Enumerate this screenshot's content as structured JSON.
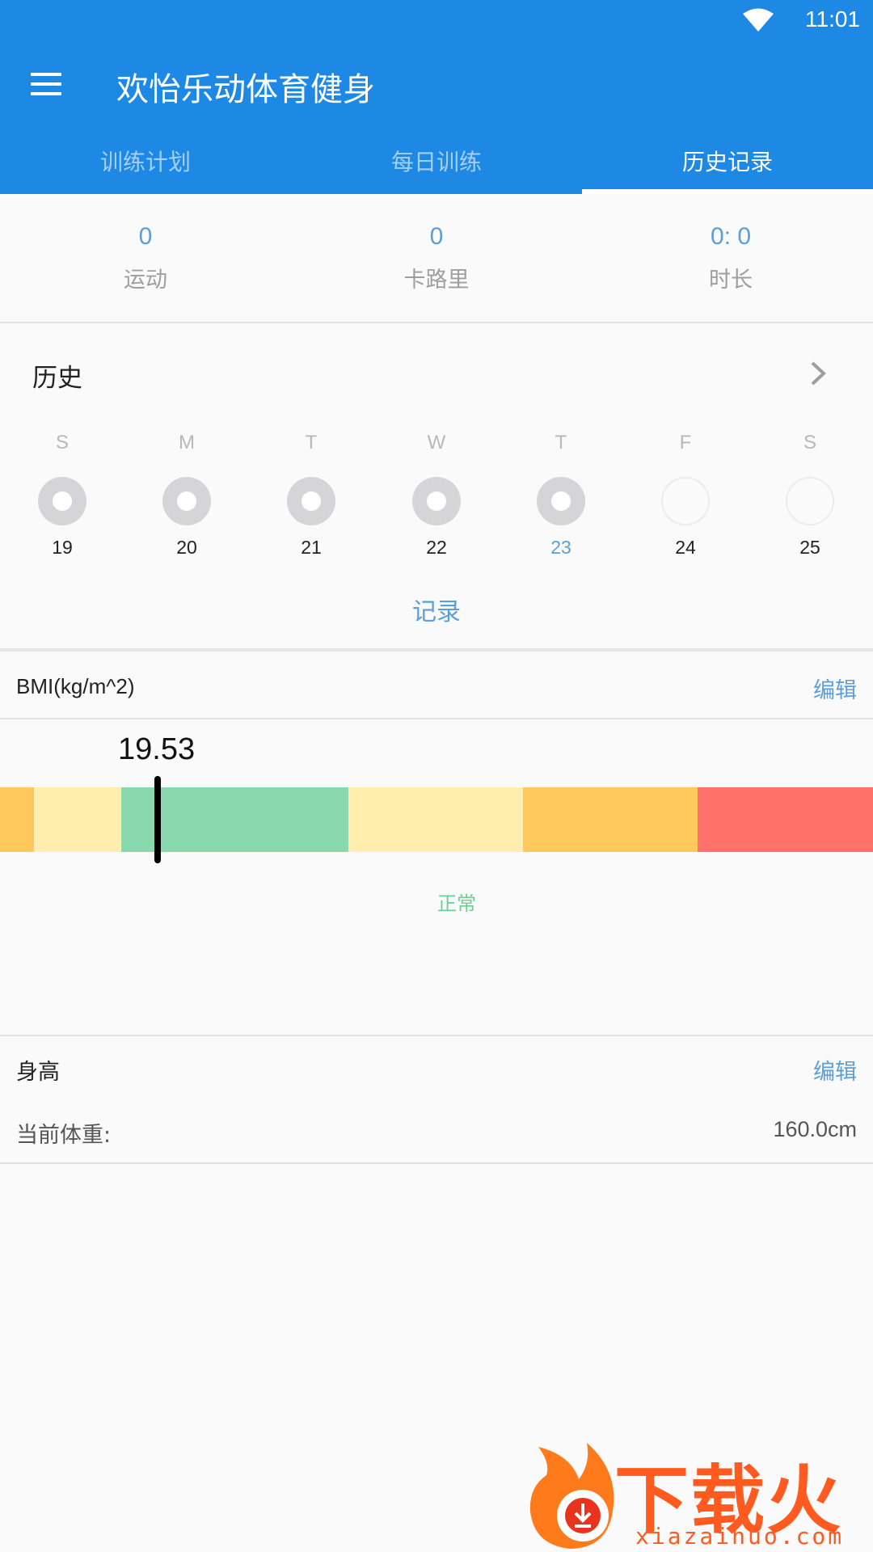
{
  "status_bar": {
    "time": "11:01",
    "wifi_icon": "wifi-icon"
  },
  "appbar": {
    "title": "欢怡乐动体育健身",
    "menu_icon": "menu-icon",
    "color": "#1e88e5",
    "tabs": [
      {
        "label": "训练计划",
        "active": false
      },
      {
        "label": "每日训练",
        "active": false
      },
      {
        "label": "历史记录",
        "active": true
      }
    ]
  },
  "stats": [
    {
      "value": "0",
      "label": "运动"
    },
    {
      "value": "0",
      "label": "卡路里"
    },
    {
      "value": "0: 0",
      "label": "时长"
    }
  ],
  "history": {
    "title": "历史",
    "chevron_icon": "chevron-right-icon",
    "days": [
      {
        "weekday": "S",
        "date": "19",
        "status": "done"
      },
      {
        "weekday": "M",
        "date": "20",
        "status": "done"
      },
      {
        "weekday": "T",
        "date": "21",
        "status": "done"
      },
      {
        "weekday": "W",
        "date": "22",
        "status": "done"
      },
      {
        "weekday": "T",
        "date": "23",
        "status": "done",
        "today": true
      },
      {
        "weekday": "F",
        "date": "24",
        "status": "empty"
      },
      {
        "weekday": "S",
        "date": "25",
        "status": "empty"
      }
    ],
    "record_label": "记录"
  },
  "bmi": {
    "title": "BMI(kg/m^2)",
    "edit_label": "编辑",
    "value": "19.53",
    "category": "正常",
    "scale_colors": [
      "#ffc85c",
      "#ffeeae",
      "#8ad9ae",
      "#ffeeae",
      "#ffc85c",
      "#ff716a"
    ]
  },
  "height_card": {
    "title": "身高",
    "edit_label": "编辑",
    "weight_label": "当前体重:",
    "weight_value": "160.0cm"
  },
  "watermark": {
    "text": "下载火",
    "url": "xiazaihuo.com",
    "logo_icon": "flame-logo-icon"
  },
  "accent_color": "#5b9fd8"
}
